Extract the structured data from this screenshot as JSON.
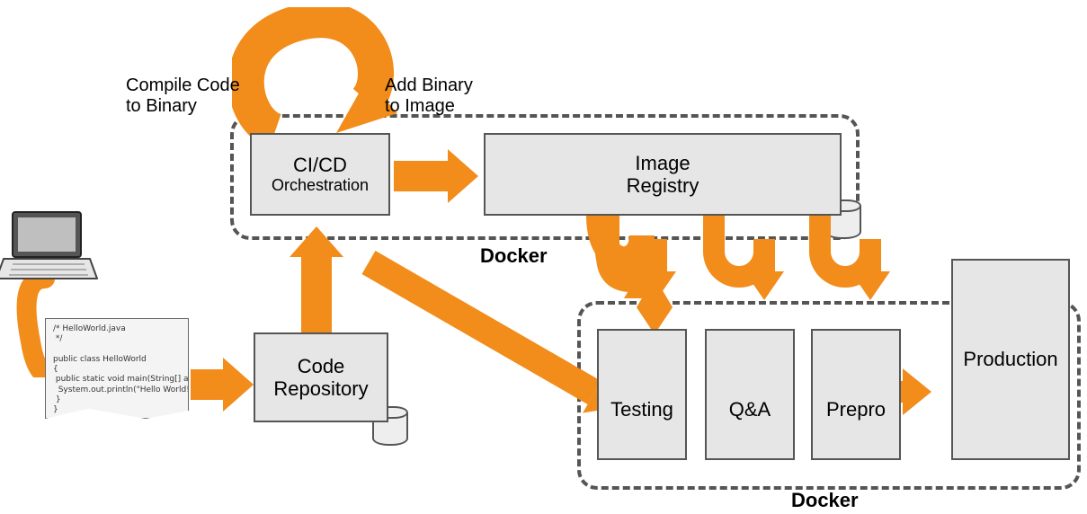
{
  "labels": {
    "compile": "Compile Code\nto Binary",
    "addBinary": "Add Binary\nto Image",
    "dockerTop": "Docker",
    "dockerBottom": "Docker"
  },
  "nodes": {
    "cicd": {
      "title": "CI/CD",
      "subtitle": "Orchestration"
    },
    "registry": {
      "title": "Image",
      "subtitle": "Registry"
    },
    "codeRepo": {
      "title": "Code",
      "subtitle": "Repository"
    },
    "testing": {
      "title": "Testing"
    },
    "qa": {
      "title": "Q&A"
    },
    "prepro": {
      "title": "Prepro"
    },
    "production": {
      "title": "Production"
    }
  },
  "code": {
    "text": "/* HelloWorld.java\n */\n\npublic class HelloWorld\n{\n public static void main(String[] args) {\n  System.out.println(\"Hello World!\");\n }\n}"
  },
  "colors": {
    "arrow": "#f28c1a",
    "boxFill": "#e6e6e6",
    "boxStroke": "#555555"
  }
}
